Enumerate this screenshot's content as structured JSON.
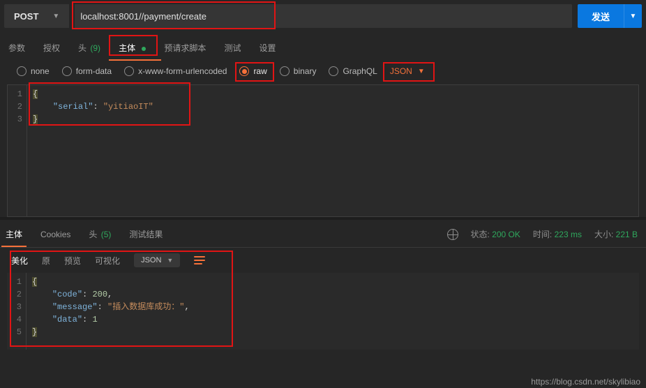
{
  "request": {
    "method": "POST",
    "url": "localhost:8001//payment/create",
    "send_label": "发送"
  },
  "req_tabs": {
    "params": "参数",
    "auth": "授权",
    "headers_label": "头",
    "headers_count": "(9)",
    "body": "主体",
    "prerequest": "预请求脚本",
    "tests": "测试",
    "settings": "设置"
  },
  "body_types": {
    "none": "none",
    "form_data": "form-data",
    "urlencoded": "x-www-form-urlencoded",
    "raw": "raw",
    "binary": "binary",
    "graphql": "GraphQL",
    "content_type": "JSON"
  },
  "request_body_lines": [
    "{",
    "    \"serial\": \"yitiaoIT\"",
    "}"
  ],
  "response_tabs": {
    "body": "主体",
    "cookies": "Cookies",
    "headers_label": "头",
    "headers_count": "(5)",
    "tests": "测试结果"
  },
  "response_meta": {
    "status_label": "状态:",
    "status_value": "200 OK",
    "time_label": "时间:",
    "time_value": "223 ms",
    "size_label": "大小:",
    "size_value": "221 B"
  },
  "response_sub": {
    "pretty": "美化",
    "raw": "原",
    "preview": "预览",
    "visualize": "可视化",
    "format": "JSON"
  },
  "response_body": {
    "code": 200,
    "message": "插入数据库成功：",
    "data": 1
  },
  "response_body_lines": [
    "{",
    "    \"code\": 200,",
    "    \"message\": \"插入数据库成功：\",",
    "    \"data\": 1",
    "}"
  ],
  "watermark": "https://blog.csdn.net/skylibiao"
}
